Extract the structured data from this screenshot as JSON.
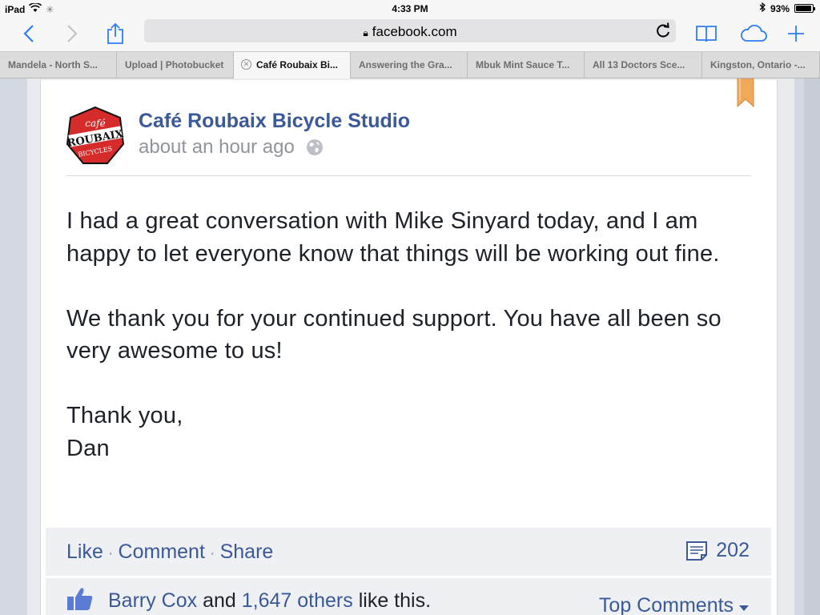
{
  "status_bar": {
    "device": "iPad",
    "time": "4:33 PM",
    "battery": "93%",
    "battery_level": 0.93
  },
  "address_bar": {
    "url": "facebook.com"
  },
  "tabs": [
    {
      "label": "Mandela - North S..."
    },
    {
      "label": "Upload | Photobucket"
    },
    {
      "label": "Café Roubaix Bi...",
      "active": true
    },
    {
      "label": "Answering the Gra..."
    },
    {
      "label": "Mbuk Mint Sauce T..."
    },
    {
      "label": "All 13 Doctors Sce..."
    },
    {
      "label": "Kingston, Ontario -..."
    }
  ],
  "post": {
    "page_name": "Café Roubaix Bicycle Studio",
    "timestamp": "about an hour ago",
    "logo": {
      "line1": "café",
      "line2": "ROUBAIX",
      "line3": "BICYCLES"
    },
    "body": {
      "p1": "I had a great conversation with Mike Sinyard today, and I am happy to let everyone know that things will be working out fine.",
      "p2": "We thank you for your continued support. You have all been so very awesome to us!",
      "p3a": "Thank you,",
      "p3b": "Dan"
    },
    "actions": {
      "like": "Like",
      "comment": "Comment",
      "share": "Share",
      "separator": "·",
      "comment_count": "202"
    },
    "likes": {
      "name": "Barry Cox",
      "and": "and",
      "others": "1,647 others",
      "suffix": "like this.",
      "top_comments": "Top Comments"
    }
  },
  "colors": {
    "link": "#3b5998",
    "safari_blue": "#2f7cf6",
    "bookmark": "#f0a95a"
  }
}
